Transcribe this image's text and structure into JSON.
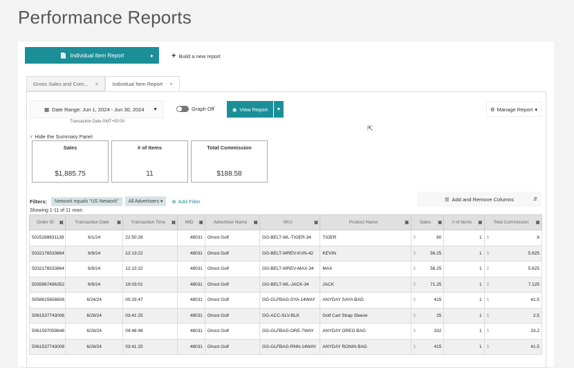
{
  "page": {
    "title": "Performance Reports"
  },
  "toolbar": {
    "individual_report_label": "Individual Item Report",
    "build_label": "Build a new report"
  },
  "tabs": [
    {
      "label": "Gross Sales and Com...",
      "close": "×"
    },
    {
      "label": "Individual Item Report",
      "close": "×"
    }
  ],
  "controls": {
    "date_range_label": "Date Range: Jun 1, 2024 - Jun 30, 2024",
    "date_sub": "Transaction Date GMT+00:00",
    "graph_label": "Graph Off",
    "view_report_label": "View Report",
    "manage_report_label": "Manage Report"
  },
  "summary": {
    "toggle_label": "Hide the Summary Panel",
    "cards": [
      {
        "label": "Sales",
        "value": "$1,885.75"
      },
      {
        "label": "# of Items",
        "value": "11"
      },
      {
        "label": "Total Commission",
        "value": "$188.58"
      }
    ]
  },
  "filters": {
    "label": "Filters:",
    "chips": [
      "Network equals \"US Network\"",
      "All Advertisers"
    ],
    "add_label": "Add Filter",
    "columns_label": "Add and Remove Columns"
  },
  "table": {
    "showing": "Showing 1-11 of 11 rows",
    "columns": [
      "Order ID",
      "Transaction Date",
      "Transaction Time",
      "MID",
      "Advertiser Name",
      "SKU",
      "Product Name",
      "Sales",
      "# of Items",
      "Total Commission"
    ],
    "currency": "$",
    "rows": [
      {
        "order": "5025288831139",
        "date": "6/1/24",
        "time": "22:50:28",
        "mid": "48031",
        "adv": "Ghost Golf",
        "sku": "GG-BELT-WL-TIGER-34",
        "product": "TIGER",
        "sales": "80",
        "items": "1",
        "comm": "8"
      },
      {
        "order": "5032176533864",
        "date": "6/9/24",
        "time": "12:13:22",
        "mid": "48031",
        "adv": "Ghost Golf",
        "sku": "GG-BELT-WREV-KVN-42",
        "product": "KEVIN",
        "sales": "56.25",
        "items": "1",
        "comm": "5.625"
      },
      {
        "order": "5032176533864",
        "date": "6/9/24",
        "time": "12:13:22",
        "mid": "48031",
        "adv": "Ghost Golf",
        "sku": "GG-BELT-WREV-MAX-34",
        "product": "MAX",
        "sales": "56.25",
        "items": "1",
        "comm": "5.625"
      },
      {
        "order": "5035967496352",
        "date": "6/9/24",
        "time": "19:03:01",
        "mid": "48031",
        "adv": "Ghost Golf",
        "sku": "GG-BELT-WL-JACK-34",
        "product": "JACK",
        "sales": "71.25",
        "items": "1",
        "comm": "7.125"
      },
      {
        "order": "5058615656608",
        "date": "6/24/24",
        "time": "00:33:47",
        "mid": "48031",
        "adv": "Ghost Golf",
        "sku": "GG-GLFBAG-SYA-14WAY",
        "product": "ANYDAY SAYA BAG",
        "sales": "415",
        "items": "1",
        "comm": "41.5"
      },
      {
        "order": "5061537743008",
        "date": "6/28/24",
        "time": "03:41:25",
        "mid": "48031",
        "adv": "Ghost Golf",
        "sku": "GG-ACC-SLV-BLK",
        "product": "Golf Cart Strap Sleeve",
        "sales": "25",
        "items": "1",
        "comm": "2.5"
      },
      {
        "order": "5061597059848",
        "date": "6/28/24",
        "time": "04:48:48",
        "mid": "48031",
        "adv": "Ghost Golf",
        "sku": "GG-GLFBAG-ORE-7WAY",
        "product": "ANYDAY OREO BAG",
        "sales": "332",
        "items": "1",
        "comm": "33.2"
      },
      {
        "order": "5061537743008",
        "date": "6/28/24",
        "time": "03:41:25",
        "mid": "48031",
        "adv": "Ghost Golf",
        "sku": "GG-GLFBAG-RNN-14WAY",
        "product": "ANYDAY RONIN BAG",
        "sales": "415",
        "items": "1",
        "comm": "41.5"
      }
    ]
  }
}
